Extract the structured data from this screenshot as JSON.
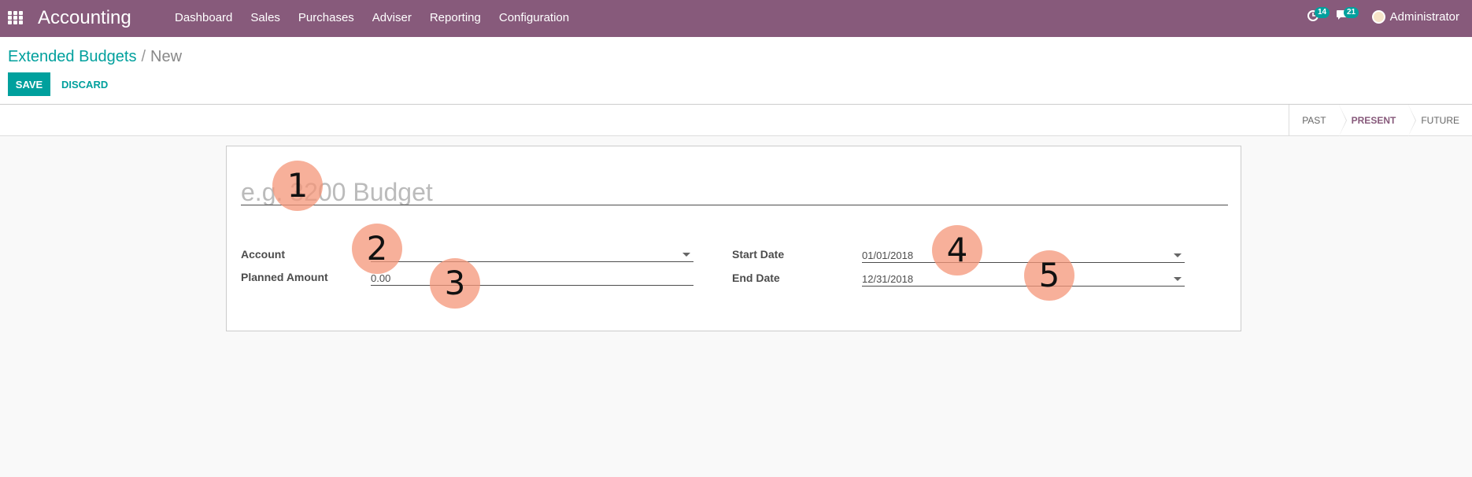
{
  "navbar": {
    "brand": "Accounting",
    "menu": [
      "Dashboard",
      "Sales",
      "Purchases",
      "Adviser",
      "Reporting",
      "Configuration"
    ],
    "activity_count": "14",
    "message_count": "21",
    "user": "Administrator"
  },
  "breadcrumb": {
    "parent": "Extended Budgets",
    "separator": "/",
    "current": "New"
  },
  "buttons": {
    "save": "SAVE",
    "discard": "DISCARD"
  },
  "stages": {
    "past": "PAST",
    "present": "PRESENT",
    "future": "FUTURE",
    "active": "PRESENT"
  },
  "form": {
    "name_placeholder": "e.g. 3200 Budget",
    "account_label": "Account",
    "account_value": "",
    "planned_amount_label": "Planned Amount",
    "planned_amount_value": "0.00",
    "start_date_label": "Start Date",
    "start_date_value": "01/01/2018",
    "end_date_label": "End Date",
    "end_date_value": "12/31/2018"
  },
  "markers": [
    "1",
    "2",
    "3",
    "4",
    "5"
  ],
  "colors": {
    "navbar": "#875a7b",
    "primary": "#00a09d",
    "marker": "#f49678"
  }
}
